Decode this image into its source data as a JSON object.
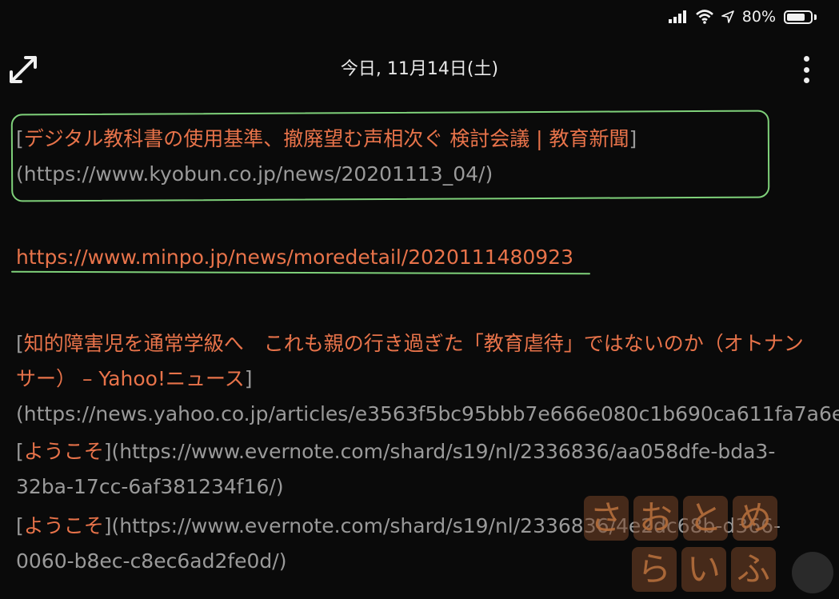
{
  "status": {
    "battery_percent": "80%",
    "battery_level": 0.8
  },
  "header": {
    "title": "今日, 11月14日(土)"
  },
  "notes": {
    "p1": {
      "open": "[",
      "link_text": "デジタル教科書の使用基準、撤廃望む声相次ぐ 検討会議 | 教育新聞",
      "mid": "](",
      "url": "https://www.kyobun.co.jp/news/20201113_04/",
      "close": ")"
    },
    "p2": {
      "url": "https://www.minpo.jp/news/moredetail/2020111480923"
    },
    "p3": {
      "open": "[",
      "link_text": "知的障害児を通常学級へ　これも親の行き過ぎた「教育虐待」ではないのか（オトナンサー） – Yahoo!ニュース",
      "mid": "](",
      "url": "https://news.yahoo.co.jp/articles/e3563f5bc95bbb7e666e080c1b690ca611fa7a6e",
      "close": ")"
    },
    "p4": {
      "open": "[",
      "link_text": "ようこそ",
      "mid": "](",
      "url": "https://www.evernote.com/shard/s19/nl/2336836/aa058dfe-bda3-32ba-17cc-6af381234f16/",
      "close": ")"
    },
    "p5": {
      "open": "[",
      "link_text": "ようこそ",
      "mid": "](",
      "url": "https://www.evernote.com/shard/s19/nl/2336836/4e2dc68b-d366-0060-b8ec-c8ec6ad2fe0d/",
      "close": ")"
    }
  },
  "watermark": {
    "row1": [
      "さ",
      "お",
      "と",
      "め"
    ],
    "row2": [
      "ら",
      "い",
      "ふ"
    ]
  },
  "colors": {
    "link": "#e8734a",
    "highlight": "#7fd17a",
    "background": "#0a0a0a"
  },
  "icons": {
    "expand": "expand-arrows-icon",
    "more": "more-vertical-icon",
    "wifi": "wifi-icon",
    "location": "location-arrow-icon",
    "battery": "battery-icon",
    "signal": "cellular-signal-icon"
  }
}
